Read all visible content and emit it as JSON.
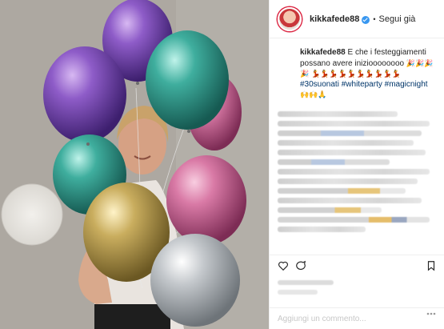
{
  "post": {
    "username": "kikkafede88",
    "verified": true,
    "separator": "•",
    "follow_label": "Segui già",
    "caption": {
      "username": "kikkafede88",
      "text": "E che i festeggiamenti possano avere inizioooooooo",
      "emoji_1": "🎉🎉🎉🎉",
      "emoji_2": "💃💃💃💃💃💃💃💃💃💃",
      "hashtag_1": "#30suonati",
      "hashtag_2": "#whiteparty",
      "hashtag_3": "#magicnight",
      "emoji_3": "🙌🙌🙏"
    },
    "add_comment_placeholder": "Aggiungi un commento..."
  },
  "photo": {
    "balloons": [
      {
        "color": "purple"
      },
      {
        "color": "purple"
      },
      {
        "color": "teal"
      },
      {
        "color": "pink"
      },
      {
        "color": "teal"
      },
      {
        "color": "pink"
      },
      {
        "color": "gold"
      },
      {
        "color": "silver"
      }
    ]
  },
  "colors": {
    "accent": "#3897f0",
    "hashtag": "#003569",
    "divider": "#efefef",
    "wall": "#a8a39c"
  },
  "icons": [
    "verified-badge-icon",
    "heart-icon",
    "comment-icon",
    "bookmark-icon",
    "more-options-icon"
  ]
}
